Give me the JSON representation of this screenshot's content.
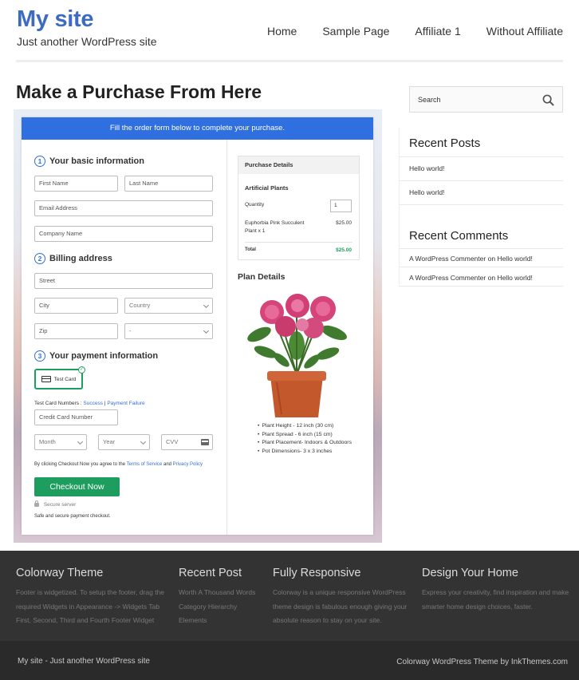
{
  "site": {
    "title": "My site",
    "tagline": "Just another WordPress site"
  },
  "nav": {
    "items": [
      "Home",
      "Sample Page",
      "Affiliate 1",
      "Without Affiliate"
    ]
  },
  "page": {
    "title": "Make a Purchase From Here"
  },
  "checkout": {
    "banner": "Fill the order form below to complete your purchase.",
    "step1": {
      "num": "1",
      "label": "Your basic information"
    },
    "step2": {
      "num": "2",
      "label": "Billing address"
    },
    "step3": {
      "num": "3",
      "label": "Your payment information"
    },
    "fields": {
      "first_name": "First Name",
      "last_name": "Last Name",
      "email": "Email Address",
      "company": "Company Name",
      "street": "Street",
      "city": "City",
      "country": "Country",
      "zip": "Zip",
      "state": "-",
      "card_number": "Credit Card Number",
      "month": "Month",
      "year": "Year",
      "cvv": "CVV"
    },
    "test_card_label": "Test Card",
    "test_numbers_label": "Test Card Numbers :",
    "success_link": "Success",
    "separator": "|",
    "failure_link": "Payment Failure",
    "terms_prefix": "By clicking Checkout Now you agree to the",
    "terms_link": "Terms of Service",
    "terms_and": "and",
    "privacy_link": "Privacy Policy",
    "checkout_button": "Checkout Now",
    "secure_server": "Secure server",
    "safe_text": "Safe and secure payment checkout."
  },
  "purchase": {
    "heading": "Purchase Details",
    "product": "Artificial Plants",
    "quantity_label": "Quantity",
    "quantity_value": "1",
    "item_name": "Euphorbia Pink Succulent",
    "item_qty": "Plant x 1",
    "item_price": "$25.00",
    "total_label": "Total",
    "total_value": "$25.00"
  },
  "plan": {
    "title": "Plan Details",
    "bullets": [
      "Plant Height - 12 inch (30 cm)",
      "Plant Spread - 6 inch (15 cm)",
      "Plant Placement- Indoors & Outdoors",
      "Pot Dimensions- 3 x 3 inches"
    ]
  },
  "sidebar": {
    "search_placeholder": "Search",
    "recent_posts_heading": "Recent Posts",
    "recent_posts": [
      "Hello world!",
      "Hello world!"
    ],
    "recent_comments_heading": "Recent Comments",
    "recent_comments": [
      {
        "author": "A WordPress Commenter",
        "on": "on",
        "post": "Hello world!"
      },
      {
        "author": "A WordPress Commenter",
        "on": "on",
        "post": "Hello world!"
      }
    ]
  },
  "footer": {
    "col1": {
      "heading": "Colorway Theme",
      "lines": [
        "Footer is widgetized. To setup the footer, drag the",
        "required Widgets in Appearance -> Widgets Tab",
        "First, Second, Third and Fourth Footer Widget"
      ]
    },
    "col2": {
      "heading": "Recent Post",
      "lines": [
        "Worth A Thousand Words",
        "Category Hierarchy",
        "Elements"
      ]
    },
    "col3": {
      "heading": "Fully Responsive",
      "lines": [
        "Colorway is a unique responsive WordPress",
        "theme design is fabulous enough giving your",
        "absolute reason to stay on your site."
      ]
    },
    "col4": {
      "heading": "Design Your Home",
      "lines": [
        "Express your creativity, find inspiration and make",
        "smarter home design choices, faster."
      ]
    },
    "bottom_left": "My site - Just another WordPress site",
    "bottom_right": "Colorway WordPress Theme by InkThemes.com"
  },
  "colors": {
    "brand": "#3d6bbf",
    "banner": "#2f6fe0",
    "button": "#1e9e5e",
    "footer": "#333333"
  }
}
